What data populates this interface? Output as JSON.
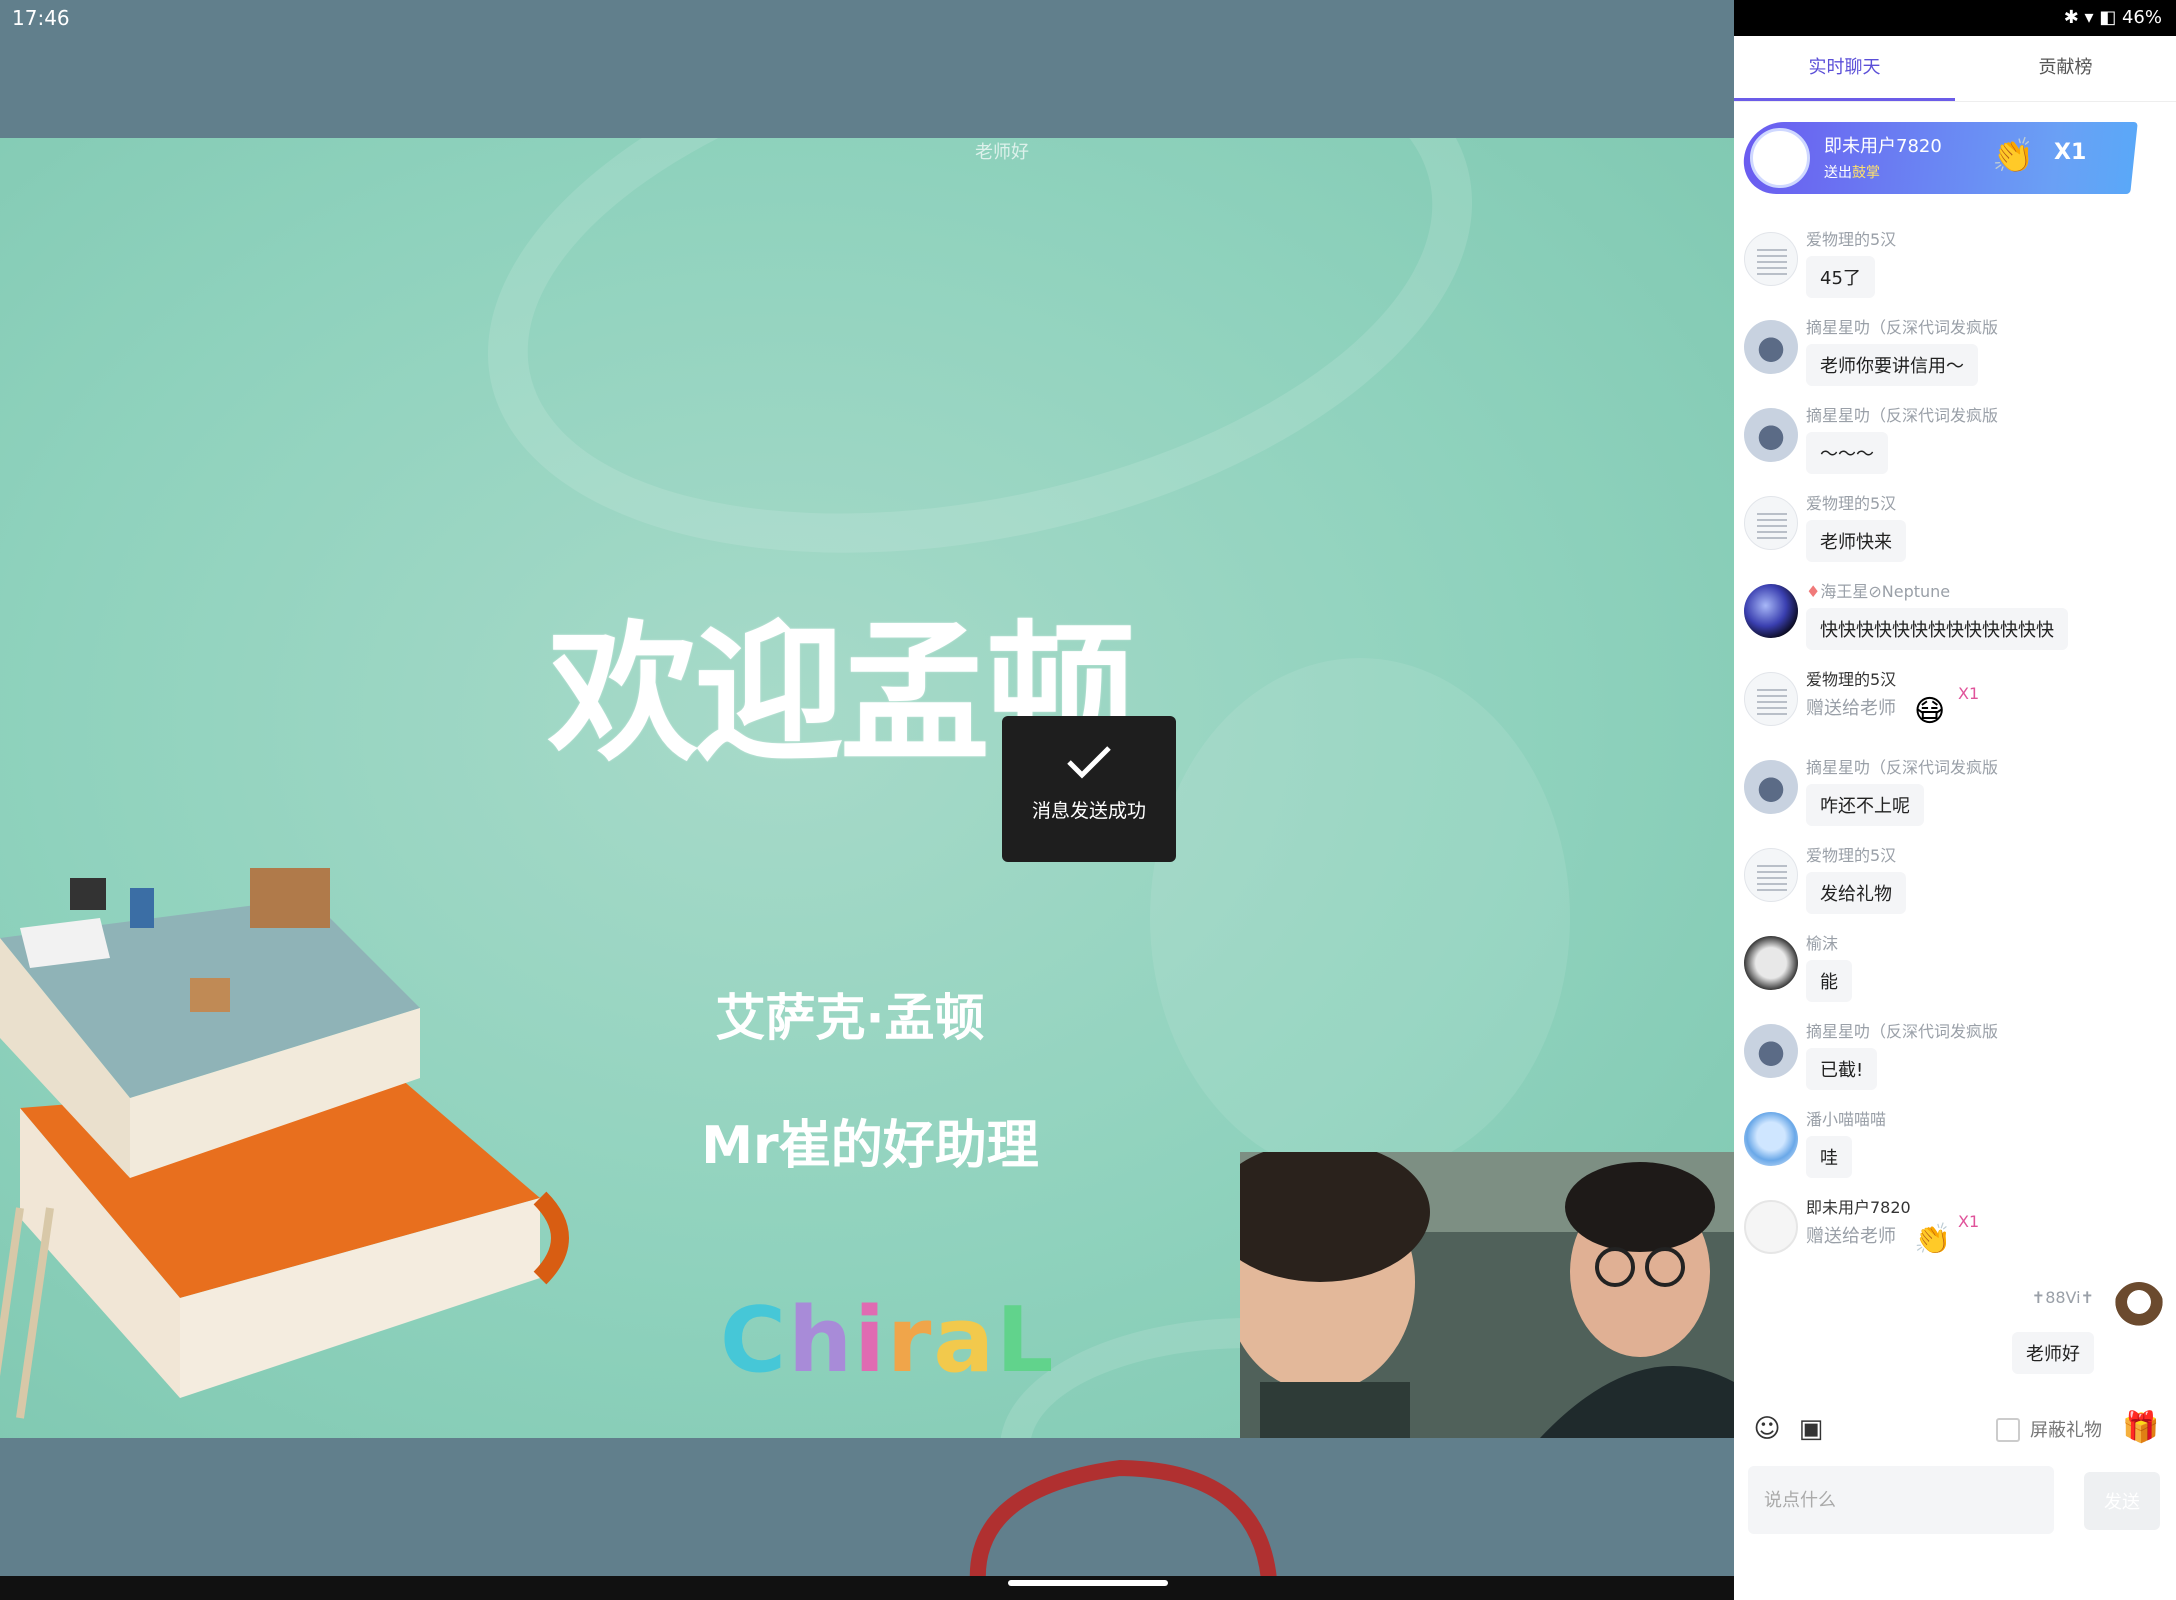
{
  "status_bar": {
    "time": "17:46",
    "battery": "46%",
    "icons": "bluetooth-icon wifi-icon battery-icon"
  },
  "slide": {
    "top_text": "老师好",
    "title": "欢迎孟顿",
    "subtitle1": "艾萨克·孟顿",
    "subtitle2": "Mr崔的好助理",
    "logo_letters": [
      "C",
      "h",
      "i",
      "r",
      "a",
      "L"
    ]
  },
  "toast": {
    "text": "消息发送成功",
    "icon": "check-icon"
  },
  "tabs": [
    {
      "label": "实时聊天",
      "active": true
    },
    {
      "label": "贡献榜",
      "active": false
    }
  ],
  "gift_banner": {
    "name": "即未用户7820",
    "action_prefix": "送出",
    "action_item": "鼓掌",
    "gift_icon": "clap-icon",
    "count": "X1"
  },
  "messages": [
    {
      "name": "爱物理的5汉",
      "text": "45了",
      "avatar": "doc"
    },
    {
      "name": "摘星星叻（反深代词发疯版",
      "text": "老师你要讲信用～",
      "avatar": "star"
    },
    {
      "name": "摘星星叻（反深代词发疯版",
      "text": "～～～",
      "avatar": "star"
    },
    {
      "name": "爱物理的5汉",
      "text": "老师快来",
      "avatar": "doc"
    },
    {
      "name": "海王星⊘Neptune",
      "text": "快快快快快快快快快快快快快",
      "avatar": "neptune",
      "badge": "♦"
    },
    {
      "name": "爱物理的5汉",
      "gift_text": "赠送给老师",
      "gift_icon": "mask-icon",
      "gift_count": "X1",
      "avatar": "doc"
    },
    {
      "name": "摘星星叻（反深代词发疯版",
      "text": "咋还不上呢",
      "avatar": "star"
    },
    {
      "name": "爱物理的5汉",
      "text": "发给礼物",
      "avatar": "doc"
    },
    {
      "name": "榆沫",
      "text": "能",
      "avatar": "chiral"
    },
    {
      "name": "摘星星叻（反深代词发疯版",
      "text": "已截!",
      "avatar": "star"
    },
    {
      "name": "潘小喵喵喵",
      "text": "哇",
      "avatar": "anime"
    },
    {
      "name": "即未用户7820",
      "gift_text": "赠送给老师",
      "gift_icon": "clap-icon",
      "gift_count": "X1",
      "avatar": "ghost"
    }
  ],
  "self_message": {
    "name": "✝88Vi✝",
    "text": "老师好"
  },
  "toolbar": {
    "block_gifts_label": "屏蔽礼物"
  },
  "input": {
    "placeholder": "说点什么",
    "send_label": "发送"
  }
}
